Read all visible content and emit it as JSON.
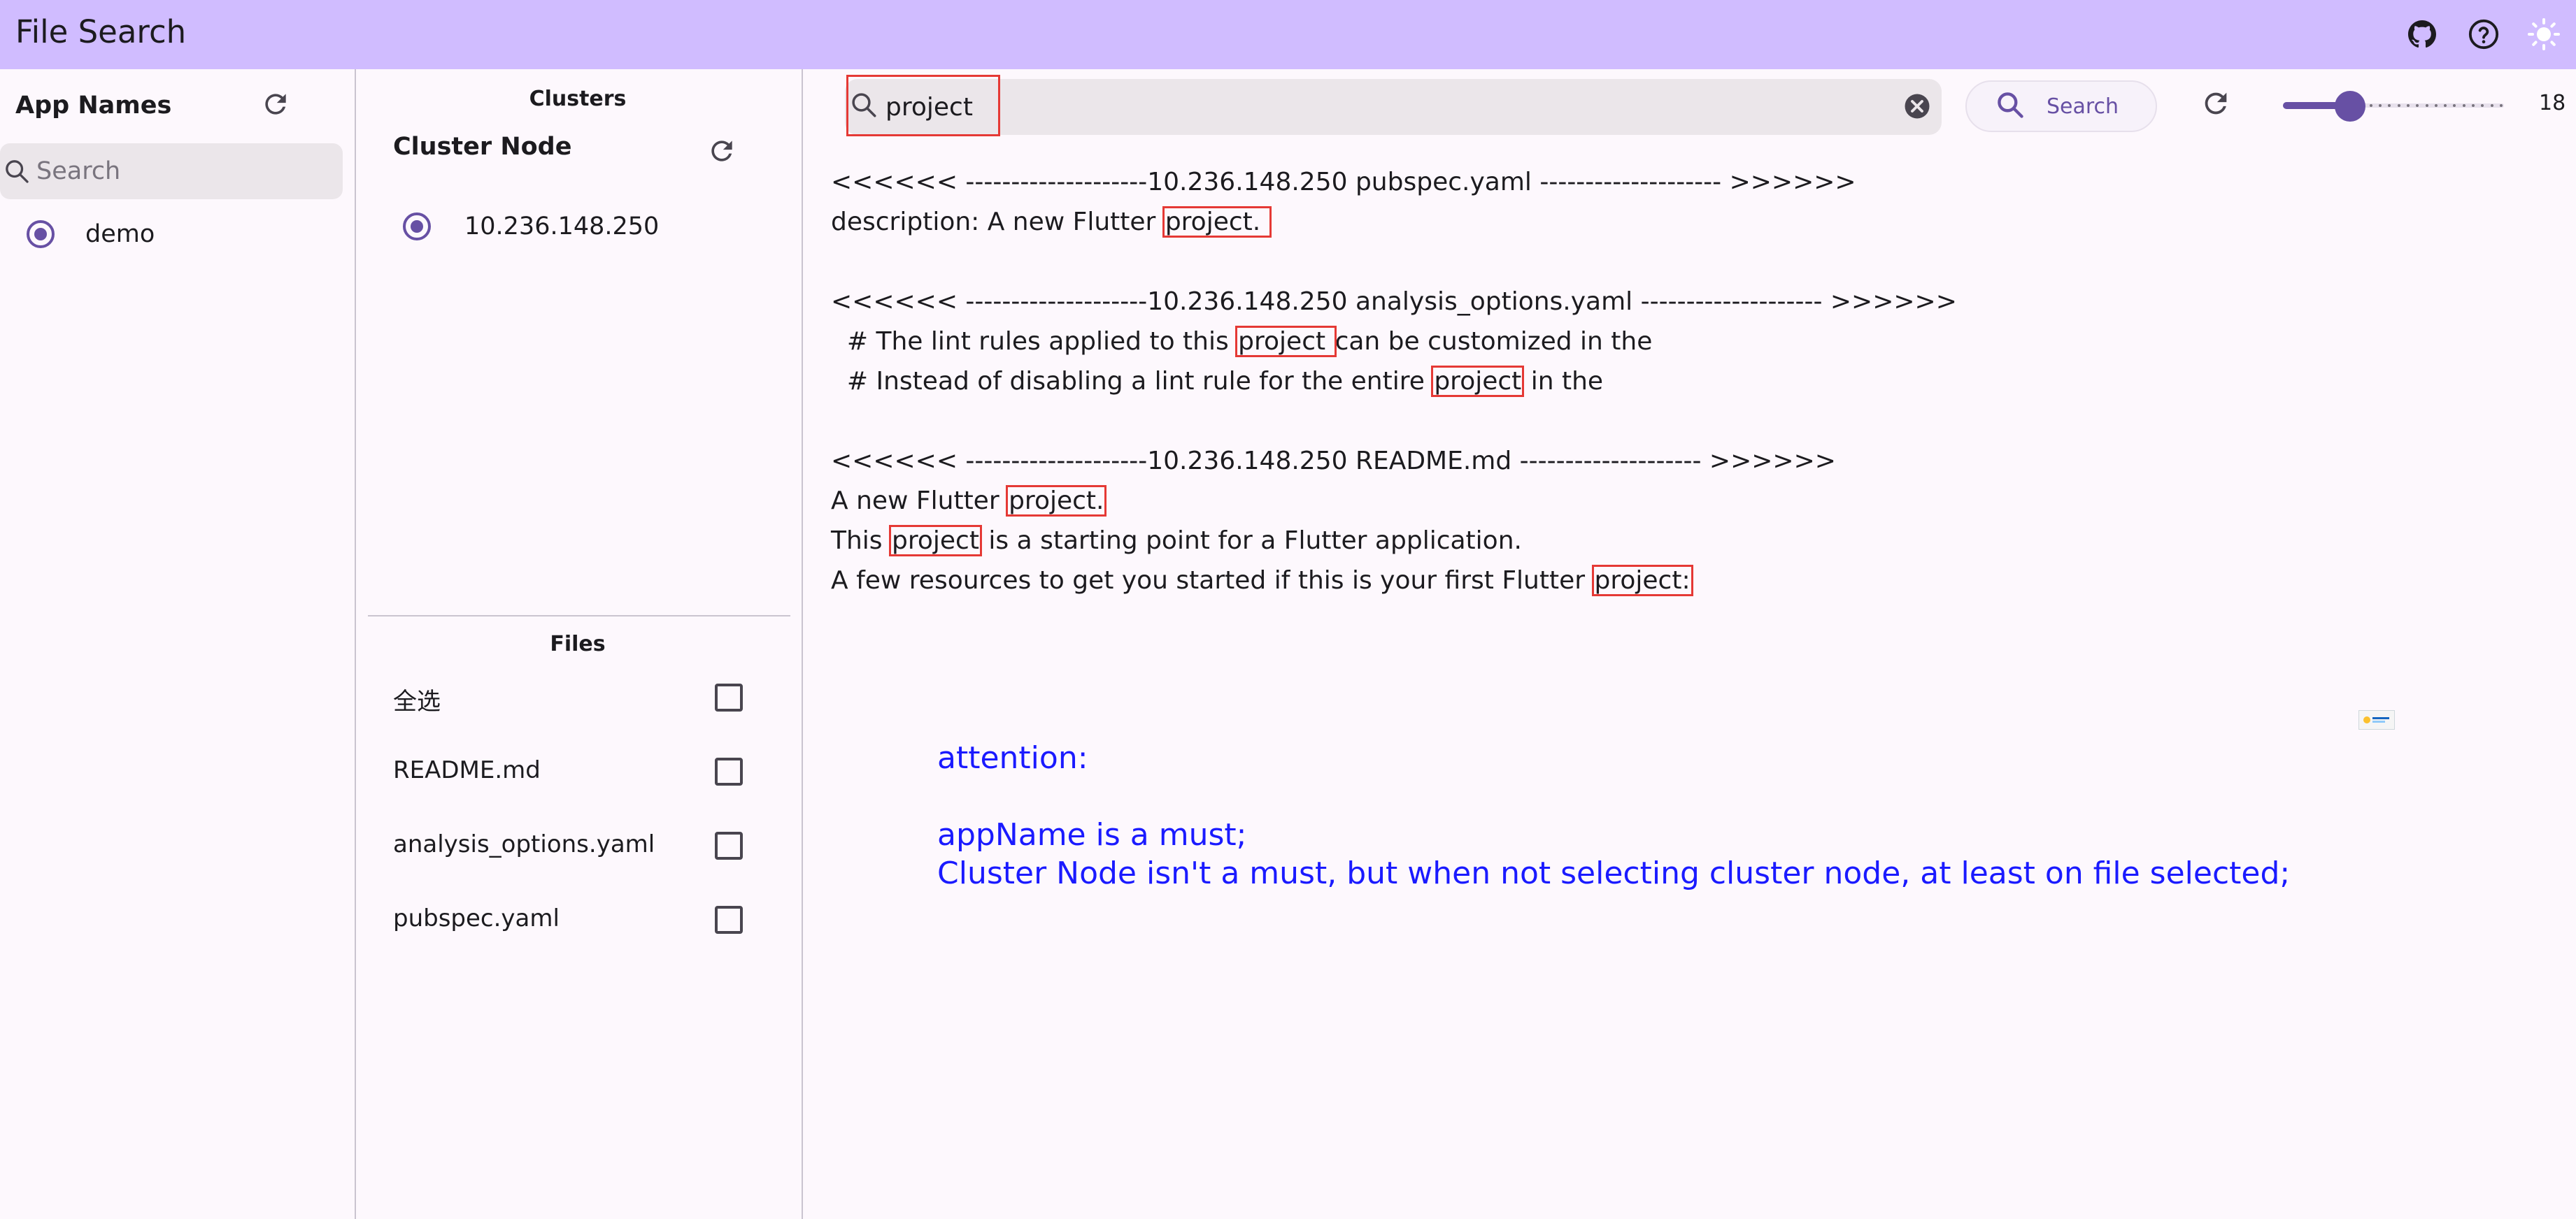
{
  "app": {
    "title": "File Search",
    "icons": [
      "github-icon",
      "help-icon",
      "theme-toggle-icon"
    ]
  },
  "left_panel": {
    "header": "App Names",
    "search_placeholder": "Search",
    "apps": [
      {
        "label": "demo",
        "selected": true
      }
    ]
  },
  "middle_panel": {
    "clusters_title": "Clusters",
    "cluster_node_header": "Cluster Node",
    "nodes": [
      {
        "label": "10.236.148.250",
        "selected": true
      }
    ],
    "files_title": "Files",
    "files": [
      {
        "label": "全选",
        "checked": false
      },
      {
        "label": "README.md",
        "checked": false
      },
      {
        "label": "analysis_options.yaml",
        "checked": false
      },
      {
        "label": "pubspec.yaml",
        "checked": false
      }
    ]
  },
  "main": {
    "search_value": "project",
    "search_button_label": "Search",
    "font_size_value": "18",
    "slider_fraction": 0.13,
    "results": [
      {
        "segments": [
          {
            "text": "<<<<<< --------------------10.236.148.250 pubspec.yaml -------------------- >>>>>>",
            "hl": false
          }
        ]
      },
      {
        "segments": [
          {
            "text": "description: A new Flutter ",
            "hl": false
          },
          {
            "text": "project. ",
            "hl": true
          }
        ]
      },
      {
        "segments": []
      },
      {
        "segments": [
          {
            "text": "<<<<<< --------------------10.236.148.250 analysis_options.yaml -------------------- >>>>>>",
            "hl": false
          }
        ]
      },
      {
        "segments": [
          {
            "text": "  # The lint rules applied to this ",
            "hl": false
          },
          {
            "text": "project ",
            "hl": true
          },
          {
            "text": "can be customized in the",
            "hl": false
          }
        ]
      },
      {
        "segments": [
          {
            "text": "  # Instead of disabling a lint rule for the entire ",
            "hl": false
          },
          {
            "text": "project",
            "hl": true
          },
          {
            "text": " in the",
            "hl": false
          }
        ]
      },
      {
        "segments": []
      },
      {
        "segments": [
          {
            "text": "<<<<<< --------------------10.236.148.250 README.md -------------------- >>>>>>",
            "hl": false
          }
        ]
      },
      {
        "segments": [
          {
            "text": "A new Flutter ",
            "hl": false
          },
          {
            "text": "project.",
            "hl": true
          }
        ]
      },
      {
        "segments": [
          {
            "text": "This ",
            "hl": false
          },
          {
            "text": "project",
            "hl": true
          },
          {
            "text": " is a starting point for a Flutter application.",
            "hl": false
          }
        ]
      },
      {
        "segments": [
          {
            "text": "A few resources to get you started if this is your first Flutter ",
            "hl": false
          },
          {
            "text": "project:",
            "hl": true
          }
        ]
      }
    ],
    "attention": [
      "attention:",
      "",
      "appName is a must;",
      "Cluster Node isn't a must, but when not selecting cluster node, at least on file selected;"
    ]
  },
  "colors": {
    "appbar": "#d0bcff",
    "accent": "#6750a4",
    "highlight_box": "#e53935",
    "attention_text": "#1a1aff"
  }
}
